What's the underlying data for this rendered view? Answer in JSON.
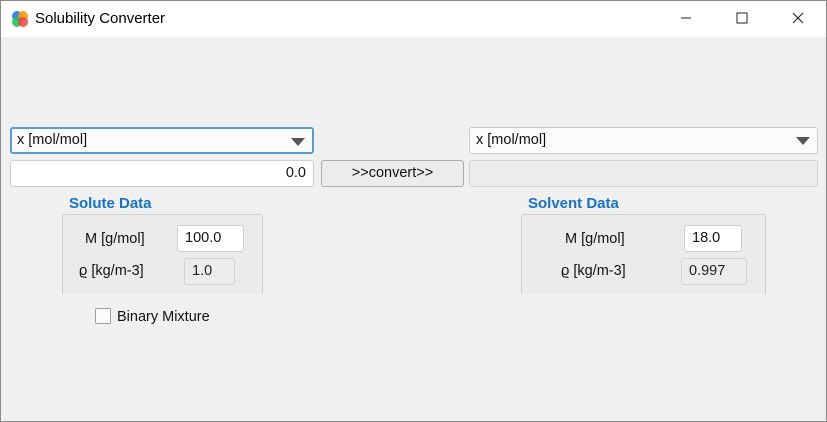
{
  "window": {
    "title": "Solubility Converter",
    "app_icon": "colorful-circles-icon",
    "controls": {
      "minimize_icon": "minimize-icon",
      "maximize_icon": "maximize-icon",
      "close_icon": "close-icon"
    }
  },
  "left": {
    "unit_select": {
      "selected": "x [mol/mol]"
    },
    "value_input": "0.0"
  },
  "convert_button": ">>convert>>",
  "right": {
    "unit_select": {
      "selected": "x [mol/mol]"
    },
    "result_output": ""
  },
  "solute": {
    "title": "Solute Data",
    "molar_mass_label": "M [g/mol]",
    "molar_mass_value": "100.0",
    "density_label": "ϱ [kg/m-3]",
    "density_value": "1.0"
  },
  "solvent": {
    "title": "Solvent Data",
    "molar_mass_label": "M [g/mol]",
    "molar_mass_value": "18.0",
    "density_label": "ϱ [kg/m-3]",
    "density_value": "0.997"
  },
  "binary_mixture": {
    "label": "Binary Mixture",
    "checked": false
  },
  "colors": {
    "accent": "#1673c9",
    "focus_border": "#5b9bd5",
    "background": "#f0f0f0"
  }
}
